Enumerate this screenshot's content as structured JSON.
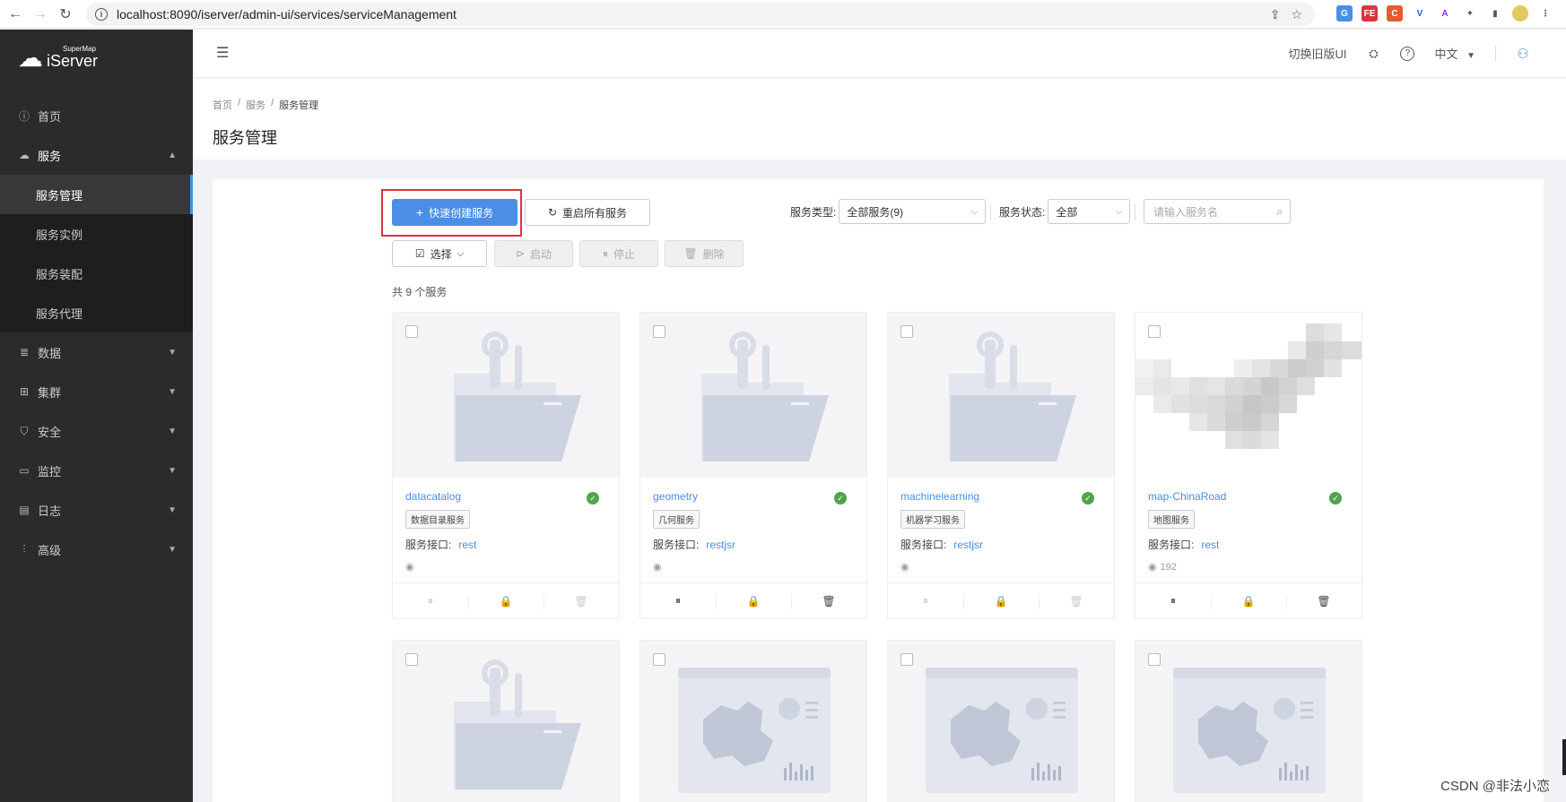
{
  "browser": {
    "url": "localhost:8090/iserver/admin-ui/services/serviceManagement"
  },
  "sidebar": {
    "logo_sup": "SuperMap",
    "logo_main": "iServer",
    "items": [
      {
        "label": "首页",
        "icon": "info-icon"
      },
      {
        "label": "服务",
        "icon": "cloud-icon"
      },
      {
        "label": "数据",
        "icon": "database-icon"
      },
      {
        "label": "集群",
        "icon": "cluster-icon"
      },
      {
        "label": "安全",
        "icon": "shield-icon"
      },
      {
        "label": "监控",
        "icon": "monitor-icon"
      },
      {
        "label": "日志",
        "icon": "log-icon"
      },
      {
        "label": "高级",
        "icon": "sliders-icon"
      }
    ],
    "sub_items": [
      {
        "label": "服务管理"
      },
      {
        "label": "服务实例"
      },
      {
        "label": "服务装配"
      },
      {
        "label": "服务代理"
      }
    ]
  },
  "header": {
    "switch_ui": "切换旧版UI",
    "language": "中文"
  },
  "breadcrumb": [
    "首页",
    "服务",
    "服务管理"
  ],
  "page_title": "服务管理",
  "toolbar": {
    "quick_create": "快速创建服务",
    "restart_all": "重启所有服务",
    "type_label": "服务类型:",
    "type_value": "全部服务(9)",
    "status_label": "服务状态:",
    "status_value": "全部",
    "search_placeholder": "请输入服务名"
  },
  "actions": {
    "select": "选择",
    "start": "启动",
    "stop": "停止",
    "delete": "删除"
  },
  "count_text": "共 9 个服务",
  "cards": [
    {
      "name": "datacatalog",
      "tag": "数据目录服务",
      "iface_label": "服务接口:",
      "iface": "rest",
      "views": "",
      "thumb": "folder"
    },
    {
      "name": "geometry",
      "tag": "几何服务",
      "iface_label": "服务接口:",
      "iface": "restjsr",
      "views": "",
      "thumb": "folder"
    },
    {
      "name": "machinelearning",
      "tag": "机器学习服务",
      "iface_label": "服务接口:",
      "iface": "restjsr",
      "views": "",
      "thumb": "folder"
    },
    {
      "name": "map-ChinaRoad",
      "tag": "地图服务",
      "iface_label": "服务接口:",
      "iface": "rest",
      "views": "192",
      "thumb": "mosaic"
    }
  ],
  "watermark": "CSDN @非法小恋",
  "colors": {
    "sidebar_bg": "#2b2b2b",
    "primary": "#4a8ee6",
    "success": "#52a34c",
    "highlight": "#d9363e"
  }
}
